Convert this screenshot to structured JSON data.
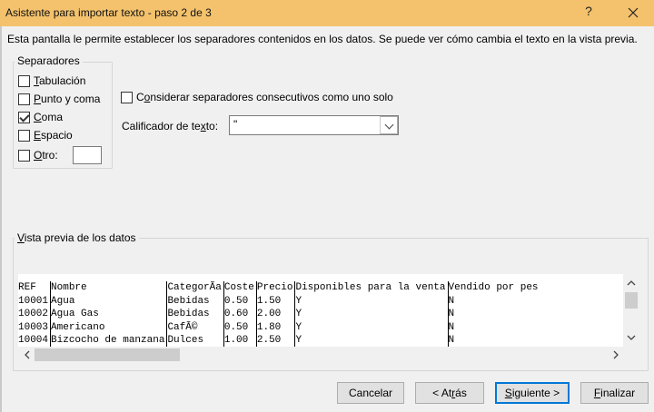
{
  "window": {
    "title": "Asistente para importar texto - paso 2 de 3",
    "help": "?",
    "close": "✕"
  },
  "intro": "Esta pantalla le permite establecer los separadores contenidos en los datos. Se puede ver cómo cambia el texto en la vista previa.",
  "separators": {
    "legend": "Separadores",
    "tab": {
      "u": "T",
      "rest": "abulación",
      "checked": false
    },
    "semicolon": {
      "u": "P",
      "rest": "unto y coma",
      "checked": false
    },
    "comma": {
      "u": "C",
      "rest": "oma",
      "checked": true
    },
    "space": {
      "u": "E",
      "rest": "spacio",
      "checked": false
    },
    "other": {
      "u": "O",
      "rest": "tro:",
      "value": "",
      "checked": false
    }
  },
  "consecutive": {
    "pre": "C",
    "u": "o",
    "rest": "nsiderar separadores consecutivos como uno solo",
    "checked": false
  },
  "qualifier": {
    "pre": "Calificador de te",
    "u": "x",
    "rest": "to:",
    "value": "\""
  },
  "preview": {
    "legend_u": "V",
    "legend_rest": "ista previa de los datos",
    "rows": [
      [
        "REF",
        "Nombre",
        "CategorÃ­a",
        "Coste",
        "Precio",
        "Disponibles para la venta",
        "Vendido por pes"
      ],
      [
        "10001",
        "Agua",
        "Bebidas",
        "0.50",
        "1.50",
        "Y",
        "N"
      ],
      [
        "10002",
        "Agua Gas",
        "Bebidas",
        "0.60",
        "2.00",
        "Y",
        "N"
      ],
      [
        "10003",
        "Americano",
        "CafÃ©",
        "0.50",
        "1.80",
        "Y",
        "N"
      ],
      [
        "10004",
        "Bizcocho de manzana",
        "Dulces",
        "1.00",
        "2.50",
        "Y",
        "N"
      ]
    ]
  },
  "buttons": {
    "cancel": "Cancelar",
    "back": {
      "pre": "< At",
      "u": "r",
      "rest": "ás"
    },
    "next": {
      "u": "S",
      "rest": "iguiente >"
    },
    "finish": {
      "u": "F",
      "rest": "inalizar"
    }
  }
}
